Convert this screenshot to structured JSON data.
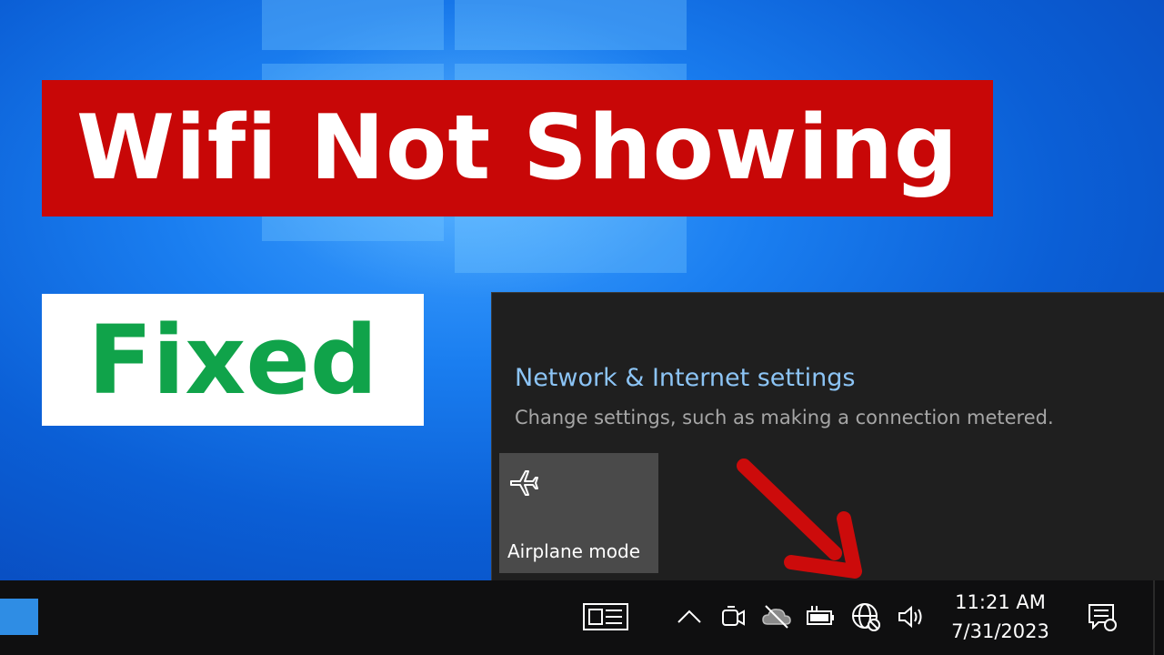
{
  "headline": "Wifi Not Showing",
  "subheadline": "Fixed",
  "network_flyout": {
    "settings_link": "Network & Internet settings",
    "settings_description": "Change settings, such as making a connection metered.",
    "quick_action": {
      "label": "Airplane mode",
      "icon": "airplane-icon"
    }
  },
  "taskbar": {
    "icons": [
      "news-widget-icon",
      "chevron-up-icon",
      "meet-now-icon",
      "onedrive-icon",
      "battery-icon",
      "globe-no-internet-icon",
      "volume-icon",
      "notifications-icon"
    ],
    "time": "11:21 AM",
    "date": "7/31/2023"
  },
  "colors": {
    "headline_bg": "#c80707",
    "fixed_text": "#10a34a",
    "link": "#8cc4f5",
    "arrow": "#cc0b0b"
  }
}
